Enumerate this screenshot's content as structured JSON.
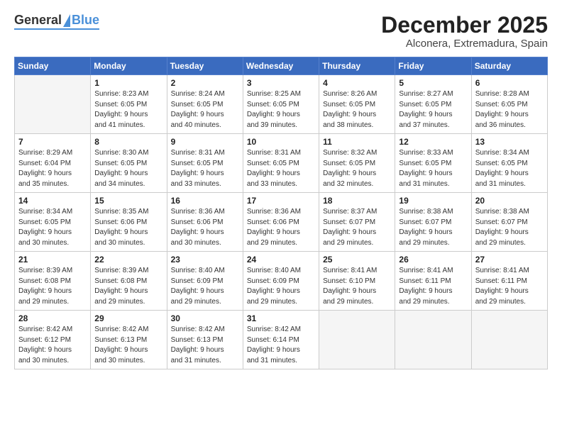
{
  "logo": {
    "general": "General",
    "blue": "Blue"
  },
  "title": "December 2025",
  "location": "Alconera, Extremadura, Spain",
  "days_of_week": [
    "Sunday",
    "Monday",
    "Tuesday",
    "Wednesday",
    "Thursday",
    "Friday",
    "Saturday"
  ],
  "weeks": [
    [
      {
        "day": "",
        "info": ""
      },
      {
        "day": "1",
        "info": "Sunrise: 8:23 AM\nSunset: 6:05 PM\nDaylight: 9 hours\nand 41 minutes."
      },
      {
        "day": "2",
        "info": "Sunrise: 8:24 AM\nSunset: 6:05 PM\nDaylight: 9 hours\nand 40 minutes."
      },
      {
        "day": "3",
        "info": "Sunrise: 8:25 AM\nSunset: 6:05 PM\nDaylight: 9 hours\nand 39 minutes."
      },
      {
        "day": "4",
        "info": "Sunrise: 8:26 AM\nSunset: 6:05 PM\nDaylight: 9 hours\nand 38 minutes."
      },
      {
        "day": "5",
        "info": "Sunrise: 8:27 AM\nSunset: 6:05 PM\nDaylight: 9 hours\nand 37 minutes."
      },
      {
        "day": "6",
        "info": "Sunrise: 8:28 AM\nSunset: 6:05 PM\nDaylight: 9 hours\nand 36 minutes."
      }
    ],
    [
      {
        "day": "7",
        "info": "Sunrise: 8:29 AM\nSunset: 6:04 PM\nDaylight: 9 hours\nand 35 minutes."
      },
      {
        "day": "8",
        "info": "Sunrise: 8:30 AM\nSunset: 6:05 PM\nDaylight: 9 hours\nand 34 minutes."
      },
      {
        "day": "9",
        "info": "Sunrise: 8:31 AM\nSunset: 6:05 PM\nDaylight: 9 hours\nand 33 minutes."
      },
      {
        "day": "10",
        "info": "Sunrise: 8:31 AM\nSunset: 6:05 PM\nDaylight: 9 hours\nand 33 minutes."
      },
      {
        "day": "11",
        "info": "Sunrise: 8:32 AM\nSunset: 6:05 PM\nDaylight: 9 hours\nand 32 minutes."
      },
      {
        "day": "12",
        "info": "Sunrise: 8:33 AM\nSunset: 6:05 PM\nDaylight: 9 hours\nand 31 minutes."
      },
      {
        "day": "13",
        "info": "Sunrise: 8:34 AM\nSunset: 6:05 PM\nDaylight: 9 hours\nand 31 minutes."
      }
    ],
    [
      {
        "day": "14",
        "info": "Sunrise: 8:34 AM\nSunset: 6:05 PM\nDaylight: 9 hours\nand 30 minutes."
      },
      {
        "day": "15",
        "info": "Sunrise: 8:35 AM\nSunset: 6:06 PM\nDaylight: 9 hours\nand 30 minutes."
      },
      {
        "day": "16",
        "info": "Sunrise: 8:36 AM\nSunset: 6:06 PM\nDaylight: 9 hours\nand 30 minutes."
      },
      {
        "day": "17",
        "info": "Sunrise: 8:36 AM\nSunset: 6:06 PM\nDaylight: 9 hours\nand 29 minutes."
      },
      {
        "day": "18",
        "info": "Sunrise: 8:37 AM\nSunset: 6:07 PM\nDaylight: 9 hours\nand 29 minutes."
      },
      {
        "day": "19",
        "info": "Sunrise: 8:38 AM\nSunset: 6:07 PM\nDaylight: 9 hours\nand 29 minutes."
      },
      {
        "day": "20",
        "info": "Sunrise: 8:38 AM\nSunset: 6:07 PM\nDaylight: 9 hours\nand 29 minutes."
      }
    ],
    [
      {
        "day": "21",
        "info": "Sunrise: 8:39 AM\nSunset: 6:08 PM\nDaylight: 9 hours\nand 29 minutes."
      },
      {
        "day": "22",
        "info": "Sunrise: 8:39 AM\nSunset: 6:08 PM\nDaylight: 9 hours\nand 29 minutes."
      },
      {
        "day": "23",
        "info": "Sunrise: 8:40 AM\nSunset: 6:09 PM\nDaylight: 9 hours\nand 29 minutes."
      },
      {
        "day": "24",
        "info": "Sunrise: 8:40 AM\nSunset: 6:09 PM\nDaylight: 9 hours\nand 29 minutes."
      },
      {
        "day": "25",
        "info": "Sunrise: 8:41 AM\nSunset: 6:10 PM\nDaylight: 9 hours\nand 29 minutes."
      },
      {
        "day": "26",
        "info": "Sunrise: 8:41 AM\nSunset: 6:11 PM\nDaylight: 9 hours\nand 29 minutes."
      },
      {
        "day": "27",
        "info": "Sunrise: 8:41 AM\nSunset: 6:11 PM\nDaylight: 9 hours\nand 29 minutes."
      }
    ],
    [
      {
        "day": "28",
        "info": "Sunrise: 8:42 AM\nSunset: 6:12 PM\nDaylight: 9 hours\nand 30 minutes."
      },
      {
        "day": "29",
        "info": "Sunrise: 8:42 AM\nSunset: 6:13 PM\nDaylight: 9 hours\nand 30 minutes."
      },
      {
        "day": "30",
        "info": "Sunrise: 8:42 AM\nSunset: 6:13 PM\nDaylight: 9 hours\nand 31 minutes."
      },
      {
        "day": "31",
        "info": "Sunrise: 8:42 AM\nSunset: 6:14 PM\nDaylight: 9 hours\nand 31 minutes."
      },
      {
        "day": "",
        "info": ""
      },
      {
        "day": "",
        "info": ""
      },
      {
        "day": "",
        "info": ""
      }
    ]
  ]
}
